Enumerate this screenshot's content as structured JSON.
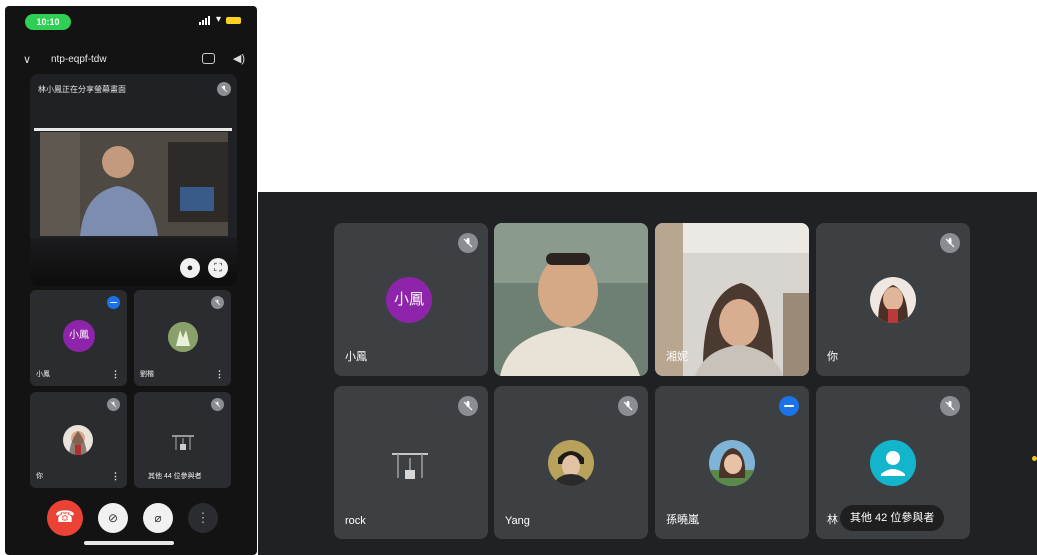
{
  "phone": {
    "status": {
      "time": "10:10"
    },
    "meeting_code": "ntp-eqpf-tdw",
    "presenting_banner": "林小鳳正在分享螢幕畫面",
    "tiles": [
      {
        "name": "小鳳",
        "avatar_letter": "小鳳"
      },
      {
        "name": "劉楷"
      },
      {
        "name": "你"
      },
      {
        "name": "其他 44 位參與者"
      }
    ]
  },
  "grid": {
    "tiles": [
      {
        "name": "小鳳",
        "avatar_letter": "小鳳",
        "avatar_color": "#8e24aa"
      },
      {
        "name": ""
      },
      {
        "name": "湘妮"
      },
      {
        "name": "你"
      },
      {
        "name": "rock"
      },
      {
        "name": "Yang"
      },
      {
        "name": "孫曉嵐"
      },
      {
        "name": "林",
        "more_label": "其他 42 位參與者"
      }
    ]
  },
  "colors": {
    "panel_bg": "#202124",
    "tile_bg": "#3c4043",
    "end_call": "#ea4335",
    "active_mic": "#1a73e8",
    "status_green": "#2fcf53"
  },
  "icons": [
    "mic-off-icon",
    "mic-active-icon",
    "chevron-down-icon",
    "camera-switch-icon",
    "speaker-icon",
    "end-call-icon",
    "camera-off-icon",
    "mic-icon",
    "more-icon",
    "default-avatar-icon"
  ]
}
